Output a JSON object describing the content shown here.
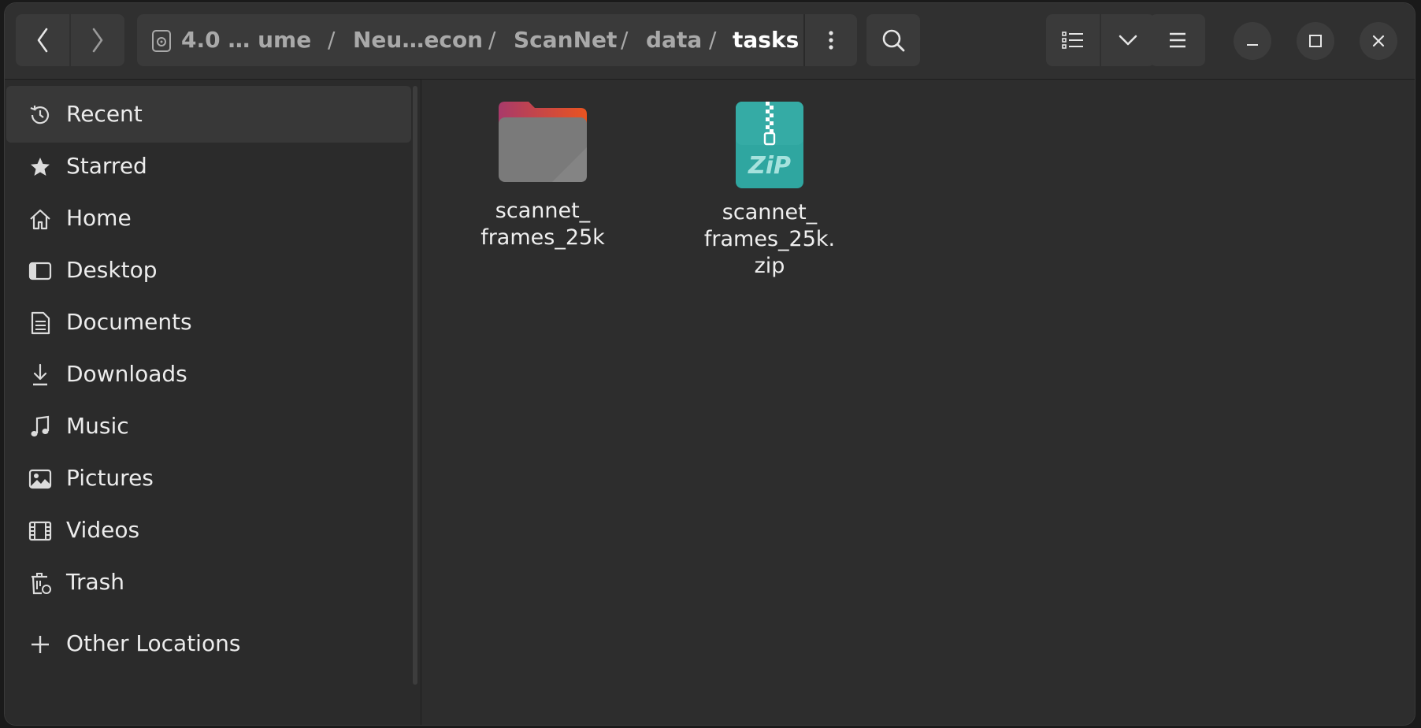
{
  "header": {
    "back_icon": "chevron-left-icon",
    "forward_icon": "chevron-right-icon",
    "path": [
      {
        "label": "4.0 …  ume"
      },
      {
        "label": "Neu…econ"
      },
      {
        "label": "ScanNet"
      },
      {
        "label": "data"
      },
      {
        "label": "tasks"
      }
    ],
    "separator": "/",
    "drive_icon": "drive-icon",
    "more_icon": "vertical-dots-icon",
    "search_icon": "search-icon",
    "view_icon": "list-view-icon",
    "view_options_icon": "chevron-down-icon",
    "menu_icon": "hamburger-menu-icon",
    "minimize_icon": "minimize-icon",
    "maximize_icon": "maximize-icon",
    "close_icon": "close-icon"
  },
  "sidebar": {
    "items": [
      {
        "label": "Recent",
        "icon": "clock-icon"
      },
      {
        "label": "Starred",
        "icon": "star-icon"
      },
      {
        "label": "Home",
        "icon": "home-icon"
      },
      {
        "label": "Desktop",
        "icon": "desktop-icon"
      },
      {
        "label": "Documents",
        "icon": "document-icon"
      },
      {
        "label": "Downloads",
        "icon": "download-icon"
      },
      {
        "label": "Music",
        "icon": "music-icon"
      },
      {
        "label": "Pictures",
        "icon": "picture-icon"
      },
      {
        "label": "Videos",
        "icon": "video-icon"
      },
      {
        "label": "Trash",
        "icon": "trash-icon"
      },
      {
        "label": "Other Locations",
        "icon": "plus-icon"
      }
    ]
  },
  "files": [
    {
      "name_line1": "scannet_",
      "name_line2": "frames_25k",
      "name_line3": "",
      "icon": "folder-icon"
    },
    {
      "name_line1": "scannet_",
      "name_line2": "frames_25k.",
      "name_line3": "zip",
      "icon": "zip-archive-icon"
    }
  ],
  "colors": {
    "folder_tab": "#e95420",
    "folder_tab_magenta": "#a83a6a",
    "folder_body": "#7a7a7a",
    "zip_teal": "#2fa6a0",
    "active_sidebar": "#383838"
  }
}
